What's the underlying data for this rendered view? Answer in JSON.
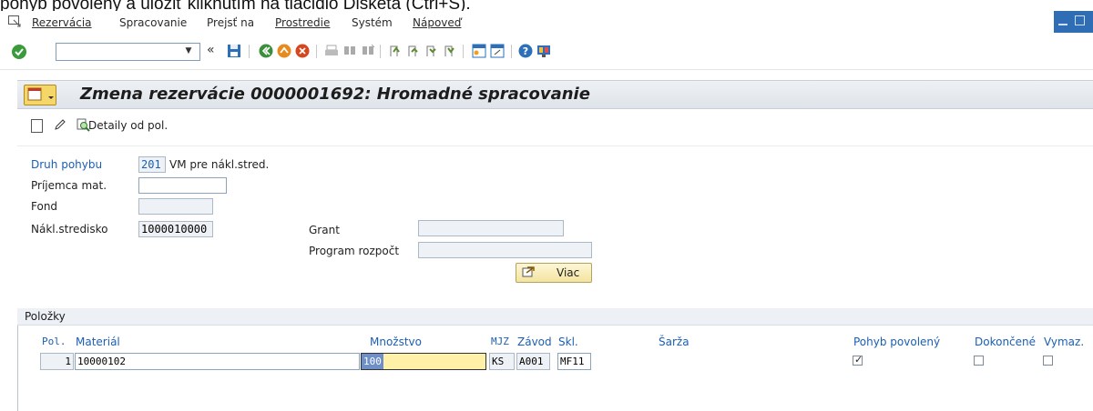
{
  "doc_caption": "pohyb povolený a uložiť kliknutím na tlačidlo Disketa (Ctrl+S).",
  "menu": {
    "items": [
      {
        "label": "Rezervácia",
        "underline_index": 0
      },
      {
        "label": "Spracovanie",
        "underline_index": 10
      },
      {
        "label": "Prejsť na",
        "underline_index": 5
      },
      {
        "label": "Prostredie",
        "underline_index": 0
      },
      {
        "label": "Systém",
        "underline_index": 1
      },
      {
        "label": "Nápoveď",
        "underline_index": 0
      }
    ]
  },
  "toolbar": {
    "command_value": "",
    "nav_back_glyph": "«",
    "icons": [
      "save-icon",
      "back-icon",
      "exit-icon",
      "cancel-icon",
      "print-icon",
      "find-icon",
      "find-next-icon",
      "first-page-icon",
      "prev-page-icon",
      "next-page-icon",
      "last-page-icon",
      "new-session-icon",
      "shortcut-icon",
      "help-icon",
      "layout-icon"
    ]
  },
  "title": "Zmena rezervácie 0000001692: Hromadné spracovanie",
  "app_toolbar": {
    "detail_label": "Detaily od pol."
  },
  "form": {
    "druh_pohybu": {
      "label": "Druh pohybu",
      "value": "201",
      "description": "VM pre nákl.stred."
    },
    "prijemca": {
      "label": "Príjemca mat.",
      "value": ""
    },
    "fond": {
      "label": "Fond",
      "value": ""
    },
    "nakl_stredisko": {
      "label": "Nákl.stredisko",
      "value": "1000010000"
    },
    "grant": {
      "label": "Grant",
      "value": ""
    },
    "program_rozpocet": {
      "label": "Program rozpočt",
      "value": ""
    },
    "viac_button": "Viac"
  },
  "items_group": {
    "title": "Položky",
    "columns": {
      "pol": "Pol.",
      "material": "Materiál",
      "mnozstvo": "Množstvo",
      "mjz": "MJZ",
      "zavod": "Závod",
      "skl": "Skl.",
      "sarza": "Šarža",
      "pohyb": "Pohyb povolený",
      "dokoncene": "Dokončené",
      "vymaz": "Vymaz."
    },
    "rows": [
      {
        "pol": "1",
        "material": "10000102",
        "mnozstvo": "100",
        "mjz": "KS",
        "zavod": "A001",
        "skl": "MF11",
        "sarza": "",
        "pohyb_povoleny": true,
        "dokoncene": false,
        "vymaz": false
      }
    ]
  },
  "colors": {
    "label_blue": "#1a5fb4",
    "focus_field": "#fff1a8",
    "title_button": "#f5d769",
    "ok_green": "#3a9b3a"
  }
}
